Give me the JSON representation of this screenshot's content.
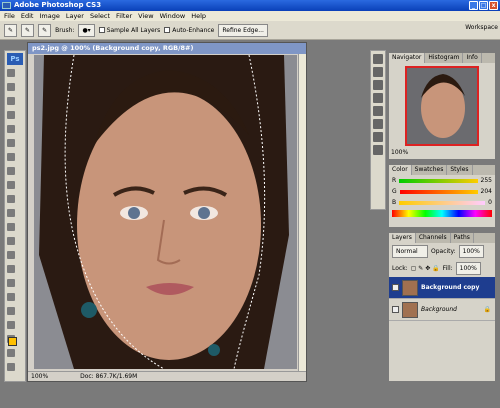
{
  "app_title": "Adobe Photoshop CS3",
  "menu": [
    "File",
    "Edit",
    "Image",
    "Layer",
    "Select",
    "Filter",
    "View",
    "Window",
    "Help"
  ],
  "options": {
    "brush_label": "Brush:",
    "sample_all": "Sample All Layers",
    "auto_enhance": "Auto-Enhance",
    "refine_edge": "Refine Edge...",
    "workspace": "Workspace"
  },
  "document": {
    "title": "ps2.jpg @ 100% (Background copy, RGB/8#)",
    "zoom": "100%",
    "doc_info": "Doc: 867.7K/1.69M"
  },
  "navigator": {
    "tabs": [
      "Navigator",
      "Histogram",
      "Info"
    ],
    "zoom": "100%"
  },
  "color": {
    "tabs": [
      "Color",
      "Swatches",
      "Styles"
    ],
    "r": "255",
    "g": "204",
    "b": "0",
    "fg": "#ffc000"
  },
  "layers": {
    "tabs": [
      "Layers",
      "Channels",
      "Paths"
    ],
    "blend": "Normal",
    "opacity_label": "Opacity:",
    "opacity": "100%",
    "lock_label": "Lock:",
    "fill_label": "Fill:",
    "fill": "100%",
    "items": [
      {
        "name": "Background copy"
      },
      {
        "name": "Background"
      }
    ]
  }
}
